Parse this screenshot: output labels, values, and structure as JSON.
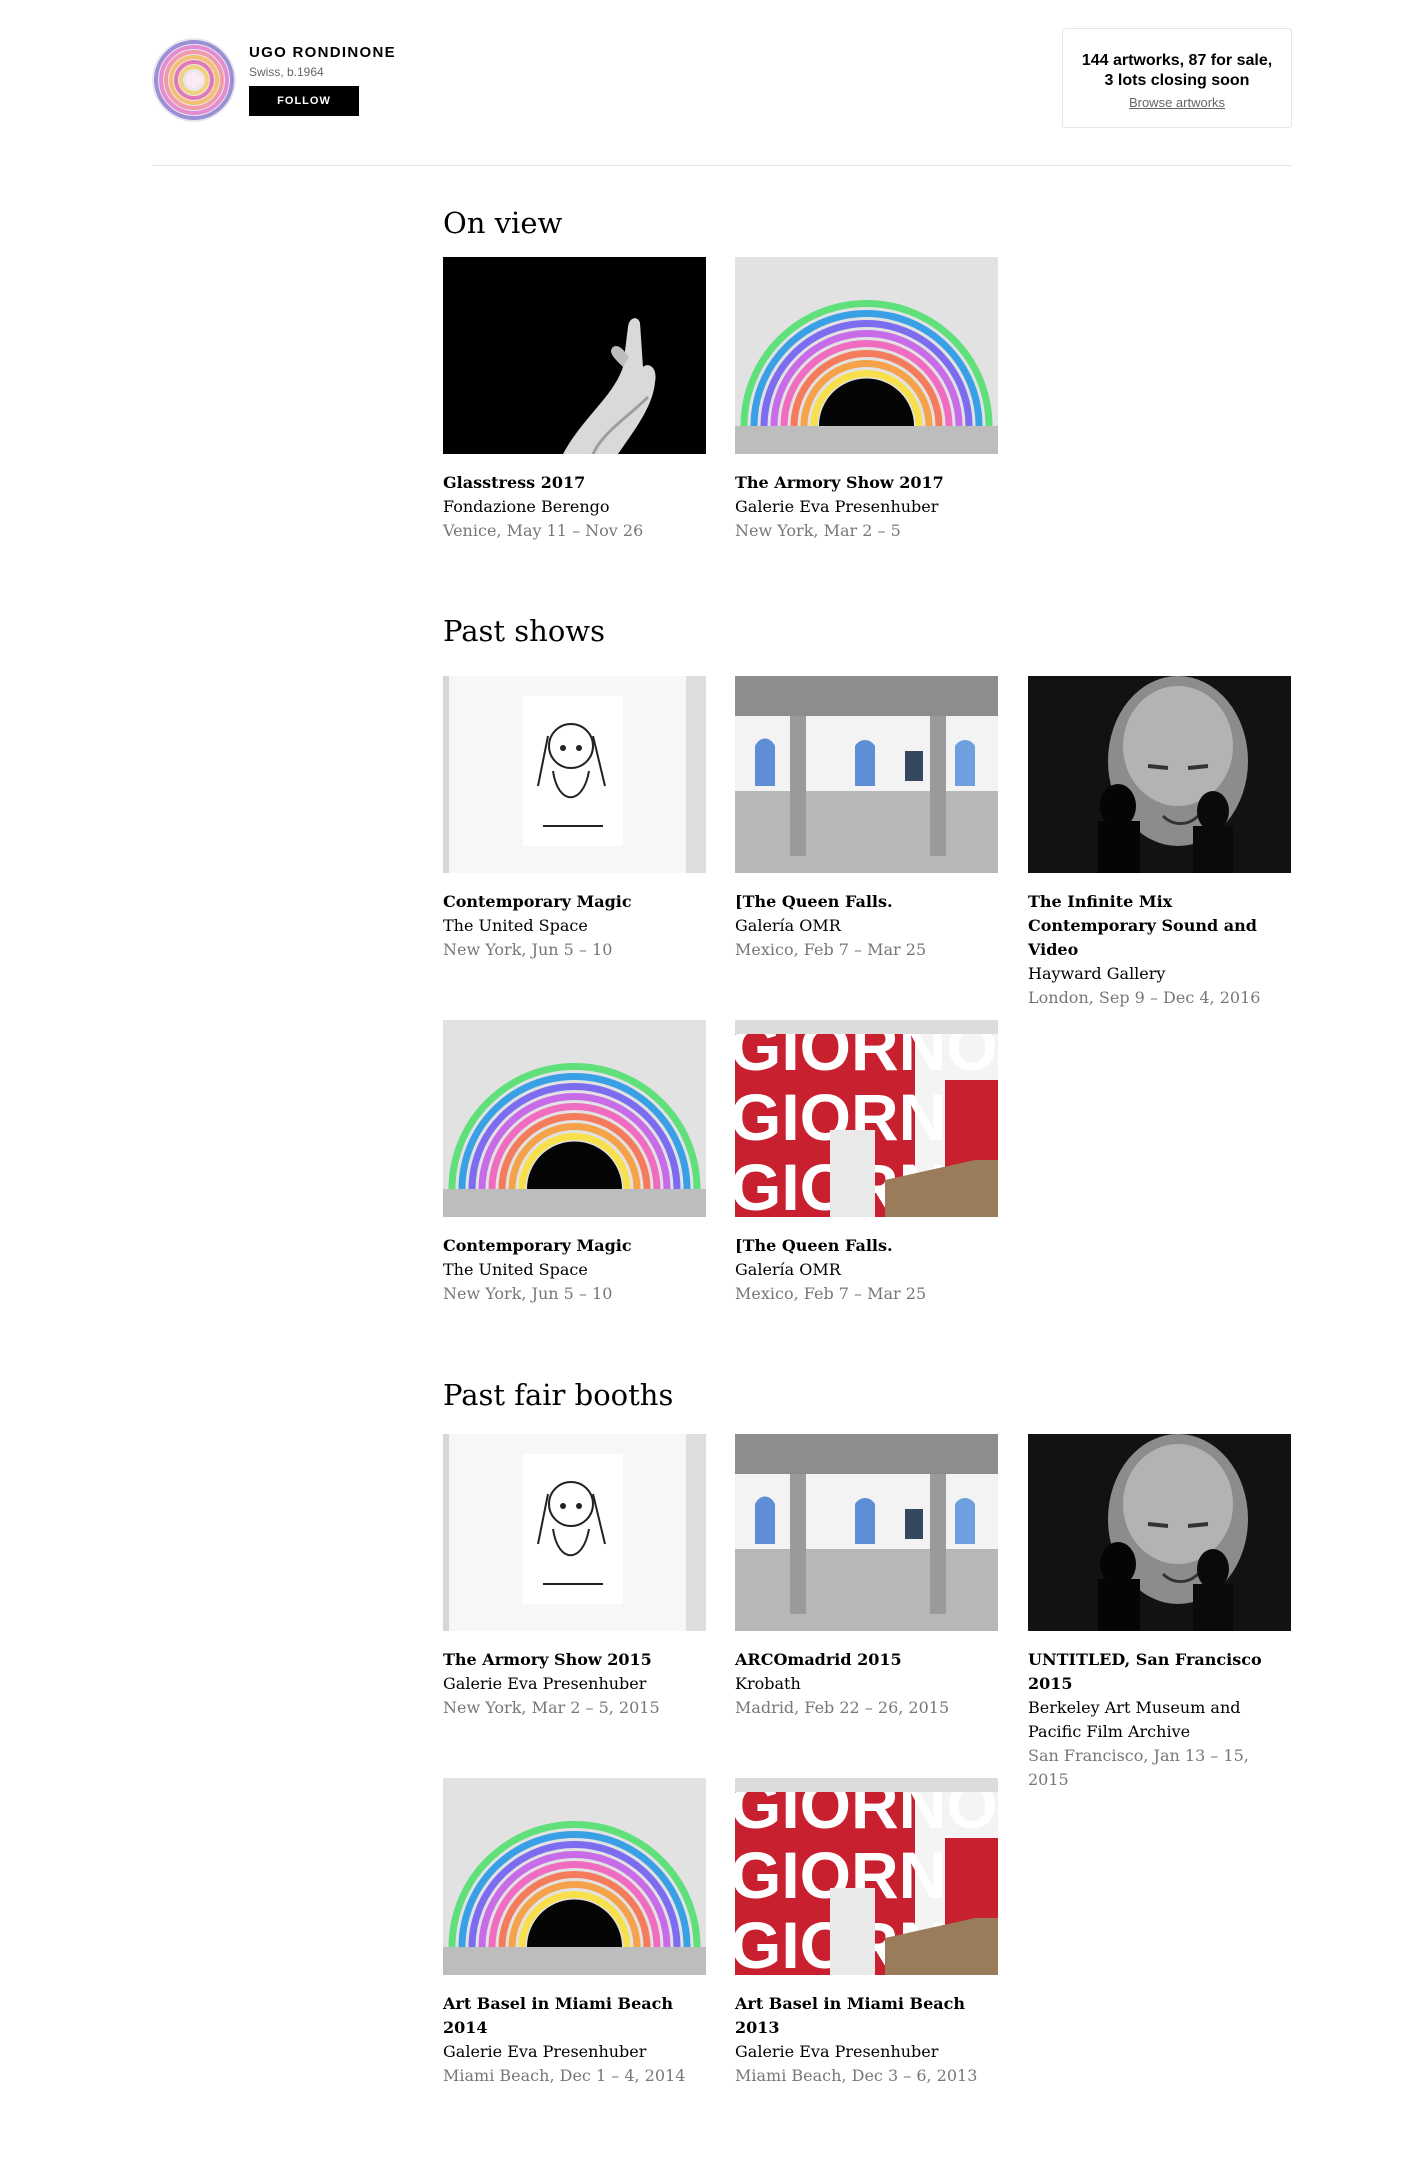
{
  "artist": {
    "name": "UGO RONDINONE",
    "meta": "Swiss, b.1964",
    "follow_label": "FOLLOW"
  },
  "cta": {
    "line1": "144 artworks, 87 for sale,",
    "line2": "3 lots closing soon",
    "link": "Browse artworks"
  },
  "sections": {
    "on_view": {
      "title": "On view",
      "cards": [
        {
          "title": "Glasstress 2017",
          "venue": "Fondazione Berengo",
          "date": "Venice, May 11 – Nov 26"
        },
        {
          "title": "The Armory Show 2017",
          "venue": "Galerie Eva Presenhuber",
          "date": "New York, Mar 2 – 5"
        }
      ]
    },
    "past_shows": {
      "title": "Past shows",
      "cards": [
        {
          "title": "Contemporary Magic",
          "venue": "The United Space",
          "date": "New York, Jun 5 – 10"
        },
        {
          "title": "[The Queen Falls.",
          "venue": "Galería OMR",
          "date": "Mexico, Feb 7 – Mar 25"
        },
        {
          "title": "The Infinite Mix Contemporary Sound and Video",
          "venue": "Hayward Gallery",
          "date": "London, Sep 9 – Dec 4, 2016"
        },
        {
          "title": "Contemporary Magic",
          "venue": "The United Space",
          "date": "New York, Jun 5 – 10"
        },
        {
          "title": "[The Queen Falls.",
          "venue": "Galería OMR",
          "date": "Mexico, Feb 7 – Mar 25"
        }
      ]
    },
    "past_fair_booths": {
      "title": "Past fair booths",
      "cards": [
        {
          "title": "The Armory Show 2015",
          "venue": "Galerie Eva Presenhuber",
          "date": "New York, Mar 2 – 5, 2015"
        },
        {
          "title": "ARCOmadrid 2015",
          "venue": "Krobath",
          "date": "Madrid, Feb 22 – 26, 2015"
        },
        {
          "title": "UNTITLED, San Francisco 2015",
          "venue": "Berkeley Art Museum and Pacific Film Archive",
          "date": "San Francisco, Jan 13 – 15, 2015"
        },
        {
          "title": "Art Basel in Miami Beach 2014",
          "venue": "Galerie Eva Presenhuber",
          "date": "Miami Beach, Dec 1 – 4, 2014"
        },
        {
          "title": "Art Basel in Miami Beach 2013",
          "venue": "Galerie Eva Presenhuber",
          "date": "Miami Beach, Dec 3 – 6, 2013"
        }
      ]
    }
  },
  "images": {
    "giorno_text": "GIORNO"
  }
}
